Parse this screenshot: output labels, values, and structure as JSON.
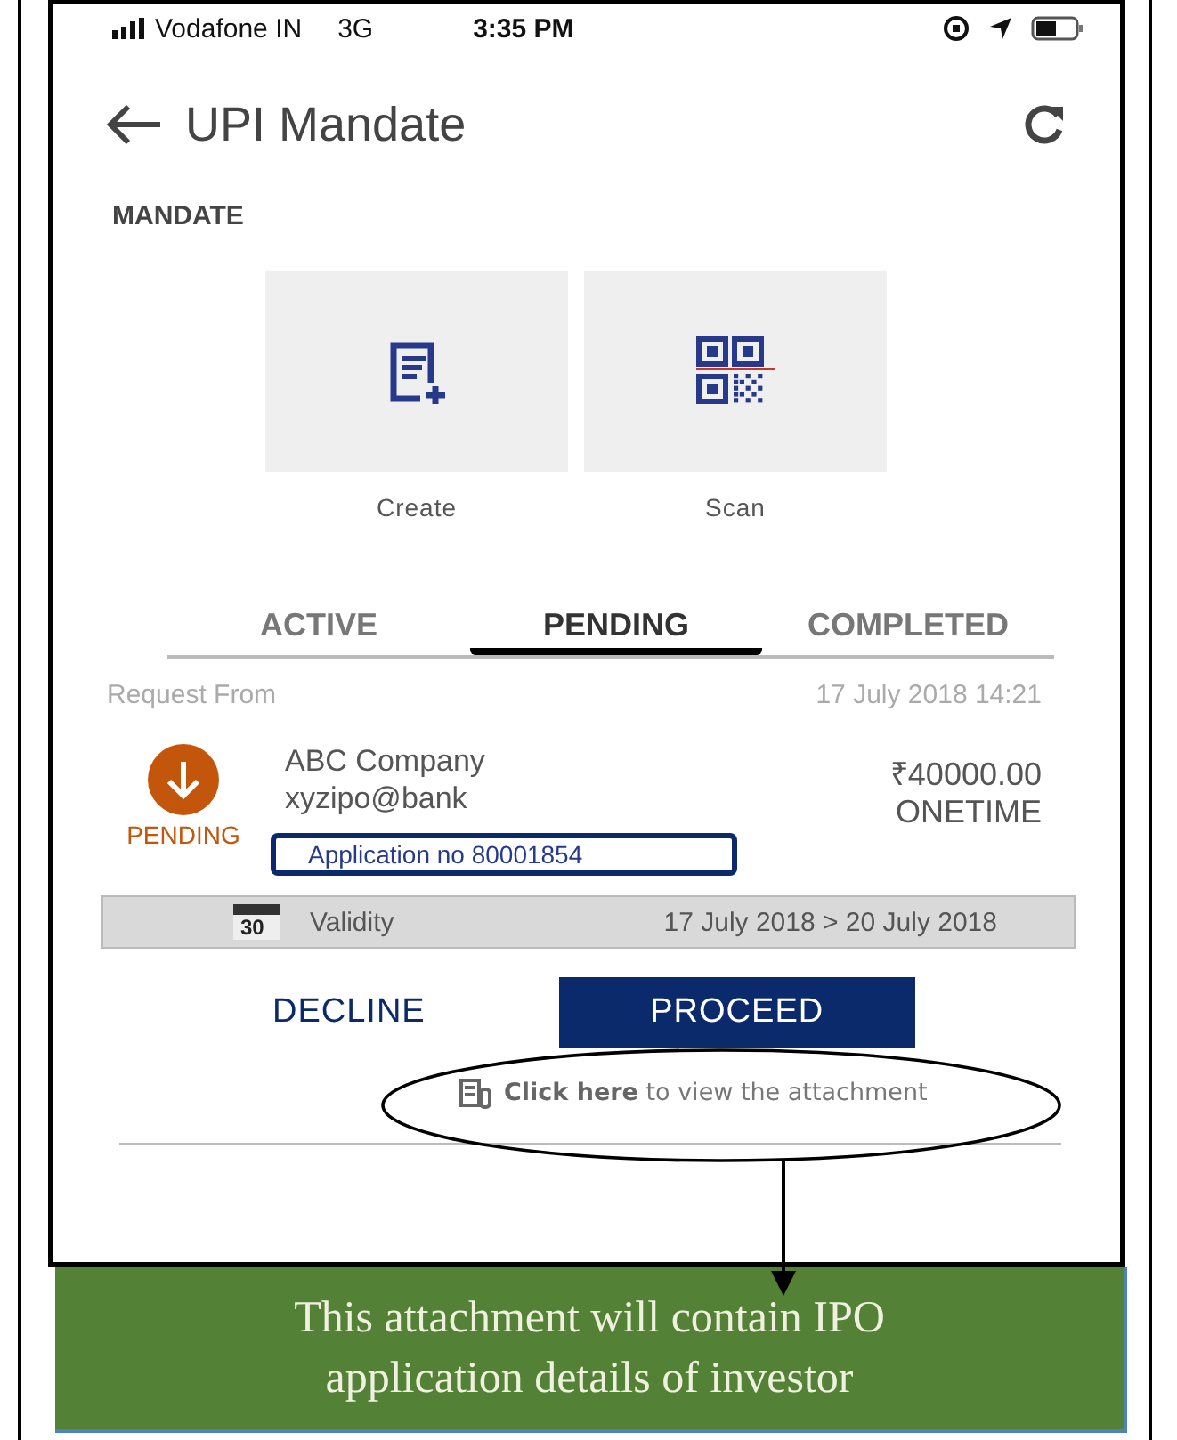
{
  "status_bar": {
    "carrier": "Vodafone IN",
    "network": "3G",
    "time": "3:35 PM"
  },
  "header": {
    "title": "UPI Mandate"
  },
  "section_title": "MANDATE",
  "actions": [
    {
      "label": "Create",
      "kind": "create"
    },
    {
      "label": "Scan",
      "kind": "scan"
    }
  ],
  "tabs": [
    {
      "label": "ACTIVE",
      "selected": false
    },
    {
      "label": "PENDING",
      "selected": true
    },
    {
      "label": "COMPLETED",
      "selected": false
    }
  ],
  "request": {
    "label": "Request From",
    "date": "17 July 2018 14:21",
    "status": "PENDING",
    "name": "ABC Company",
    "vpa": "xyzipo@bank",
    "amount": "₹40000.00",
    "frequency": "ONETIME",
    "application": "Application no 80001854",
    "calendar_day": "30",
    "validity_label": "Validity",
    "validity": "17 July 2018 > 20 July 2018"
  },
  "buttons": [
    {
      "label": "DECLINE",
      "kind": "text"
    },
    {
      "label": "PROCEED",
      "kind": "filled"
    }
  ],
  "attachment_link": "**Click here** to view the attachment",
  "annotation": {
    "text": "This attachment will contain IPO application details of investor"
  }
}
